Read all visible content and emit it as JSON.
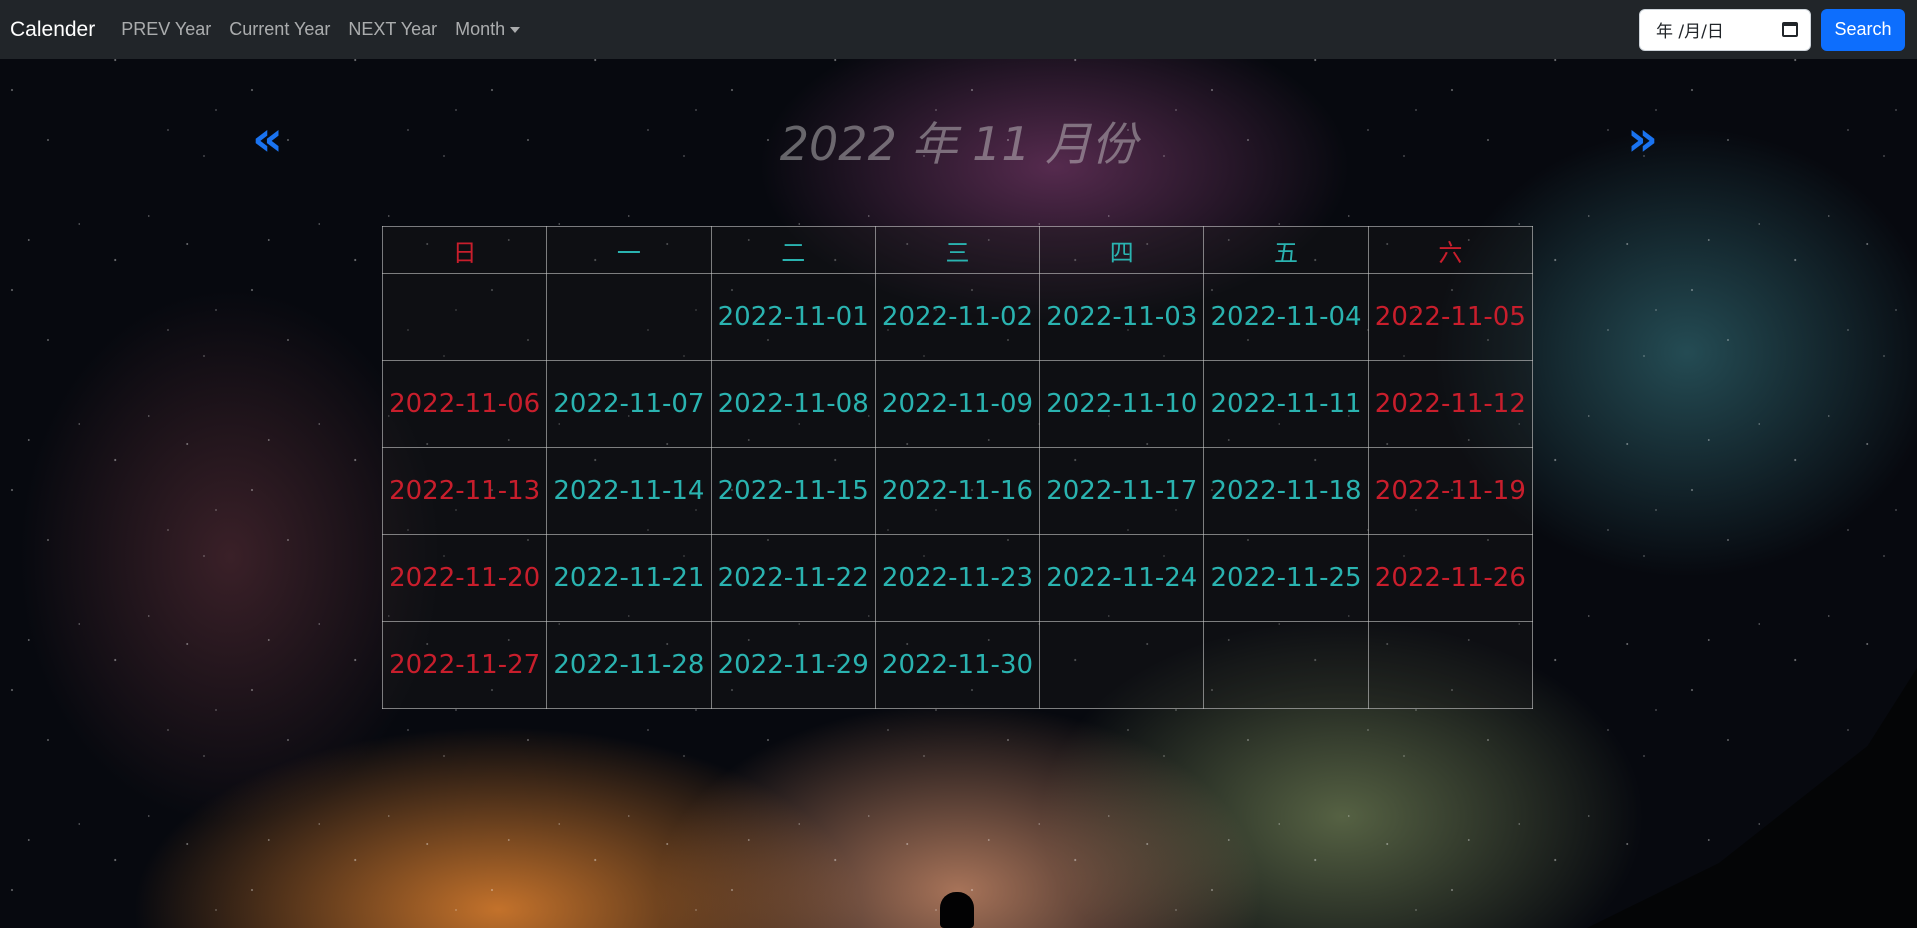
{
  "navbar": {
    "brand": "Calender",
    "links": [
      "PREV Year",
      "Current Year",
      "NEXT Year",
      "Month"
    ],
    "date_input": {
      "value": "年 /月/日"
    },
    "search_label": "Search"
  },
  "calendar": {
    "title": "2022 年 11 月份",
    "prev_arrow": "«",
    "next_arrow": "»",
    "weekdays": [
      "日",
      "一",
      "二",
      "三",
      "四",
      "五",
      "六"
    ],
    "weeks": [
      [
        "",
        "",
        "2022-11-01",
        "2022-11-02",
        "2022-11-03",
        "2022-11-04",
        "2022-11-05"
      ],
      [
        "2022-11-06",
        "2022-11-07",
        "2022-11-08",
        "2022-11-09",
        "2022-11-10",
        "2022-11-11",
        "2022-11-12"
      ],
      [
        "2022-11-13",
        "2022-11-14",
        "2022-11-15",
        "2022-11-16",
        "2022-11-17",
        "2022-11-18",
        "2022-11-19"
      ],
      [
        "2022-11-20",
        "2022-11-21",
        "2022-11-22",
        "2022-11-23",
        "2022-11-24",
        "2022-11-25",
        "2022-11-26"
      ],
      [
        "2022-11-27",
        "2022-11-28",
        "2022-11-29",
        "2022-11-30",
        "",
        "",
        ""
      ]
    ]
  },
  "colors": {
    "weekend": "#c81e2c",
    "weekday": "#2ab3b0",
    "accent": "#0d6efd",
    "navbar_bg": "#212529"
  }
}
